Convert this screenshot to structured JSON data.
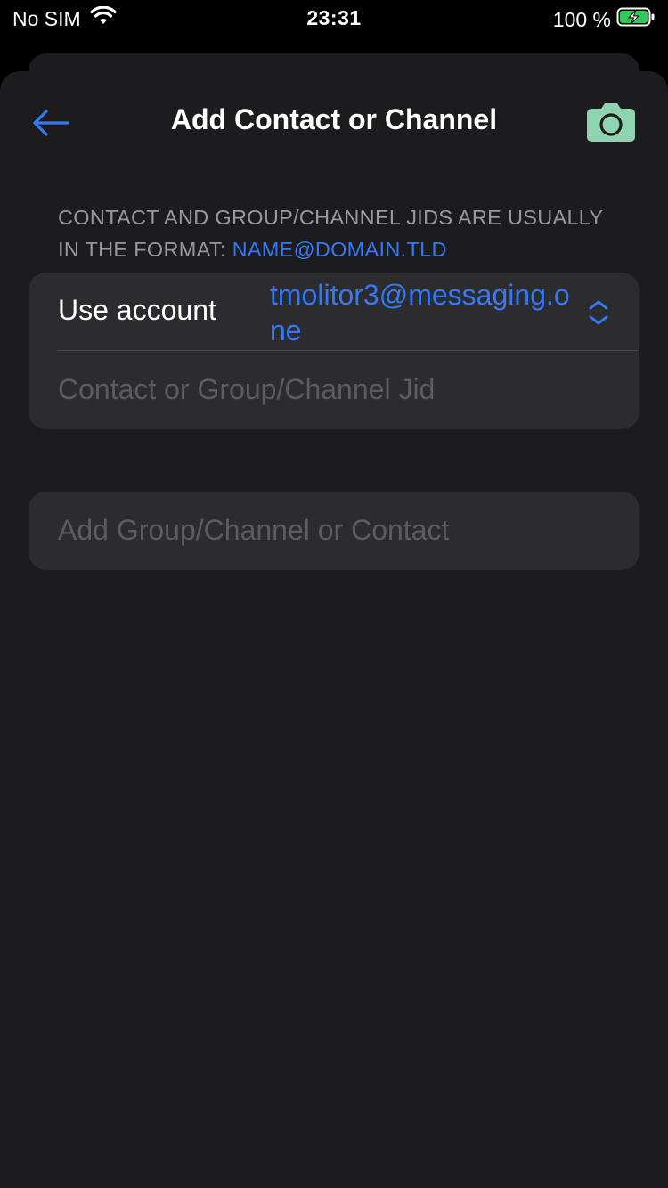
{
  "status_bar": {
    "carrier": "No SIM",
    "time": "23:31",
    "battery_percent": "100 %",
    "icons": [
      "wifi-icon",
      "battery-charging-icon"
    ]
  },
  "nav": {
    "title": "Add Contact or Channel",
    "back_icon": "arrow-left-icon",
    "camera_icon": "camera-icon"
  },
  "hint": {
    "text": "CONTACT AND GROUP/CHANNEL JIDS ARE USUALLY IN THE FORMAT: ",
    "format_link": "NAME@DOMAIN.TLD"
  },
  "form": {
    "account_label": "Use account",
    "account_value": "tmolitor3@messaging.one",
    "account_icon": "chevron-up-down-icon",
    "jid_placeholder": "Contact or Group/Channel Jid",
    "jid_value": ""
  },
  "add_button": {
    "label": "Add Group/Channel or Contact"
  },
  "colors": {
    "background": "#1c1c1e",
    "card": "#2c2c2e",
    "accent_blue": "#3478f6",
    "camera_green": "#8fd3b0",
    "secondary_text": "#98989f",
    "placeholder_text": "#5b5b60",
    "battery_green": "#34c759"
  }
}
